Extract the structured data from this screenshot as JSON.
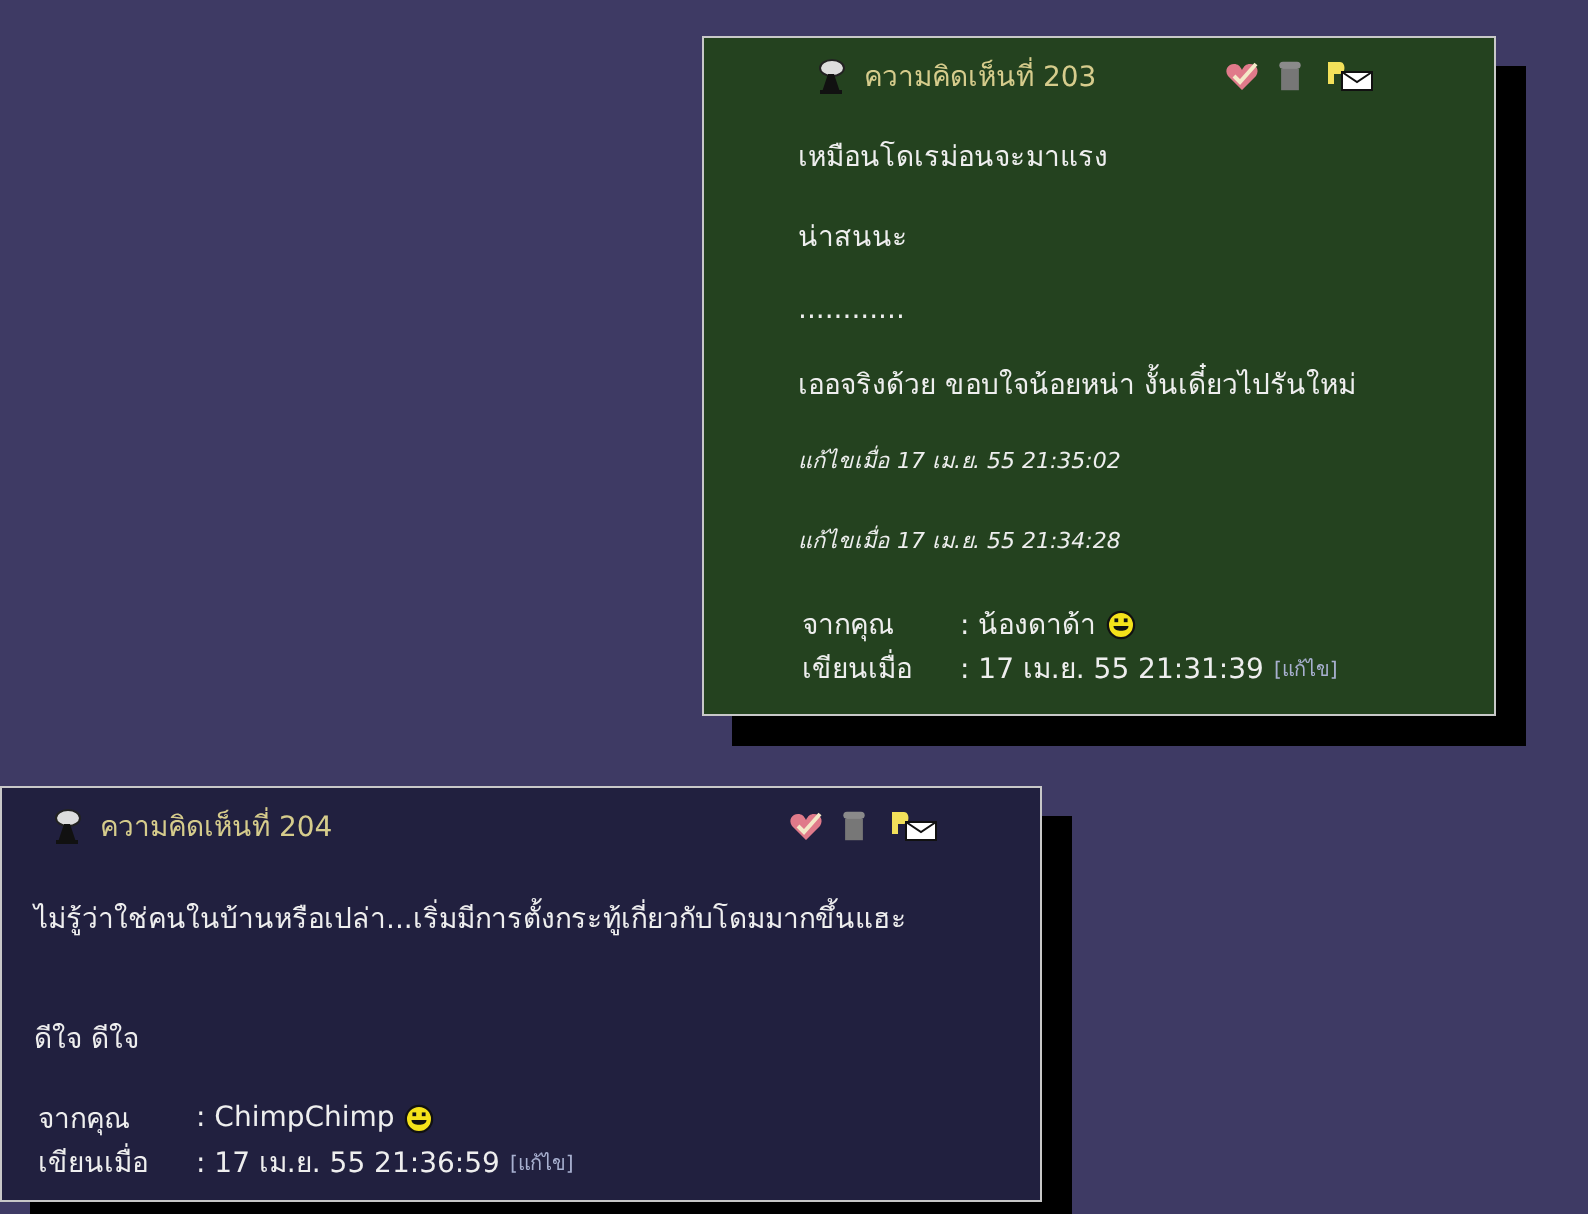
{
  "comments": [
    {
      "title": "ความคิดเห็นที่ 203",
      "color": "#24421f",
      "paragraphs": [
        {
          "kind": "text",
          "text": "เหมือนโดเรม่อนจะมาแรง"
        },
        {
          "kind": "text",
          "text": "น่าสนนะ"
        },
        {
          "kind": "text",
          "text": "............"
        },
        {
          "kind": "text",
          "text": "เออจริงด้วย ขอบใจน้อยหน่า งั้นเดี๋ยวไปรันใหม่"
        },
        {
          "kind": "edit_note",
          "text": "แก้ไขเมื่อ 17 เม.ย. 55 21:35:02"
        },
        {
          "kind": "edit_note",
          "text": "แก้ไขเมื่อ 17 เม.ย. 55 21:34:28"
        }
      ],
      "from_label": "จากคุณ",
      "author": ": น้องดาด้า",
      "written_label": "เขียนเมื่อ",
      "date": ": 17 เม.ย. 55 21:31:39",
      "edit_link": "[แก้ไข]"
    },
    {
      "title": "ความคิดเห็นที่ 204",
      "color": "#21203f",
      "paragraphs": [
        {
          "kind": "text",
          "text": "ไม่รู้ว่าใช่คนในบ้านหรือเปล่า...เริ่มมีการตั้งกระทู้เกี่ยวกับโดมมากขึ้นแฮะ"
        },
        {
          "kind": "text_after_blank_line",
          "text": "ดีใจ ดีใจ"
        }
      ],
      "from_label": "จากคุณ",
      "author": ": ChimpChimp",
      "written_label": "เขียนเมื่อ",
      "date": ": 17 เม.ย. 55 21:36:59",
      "edit_link": "[แก้ไข]"
    }
  ]
}
